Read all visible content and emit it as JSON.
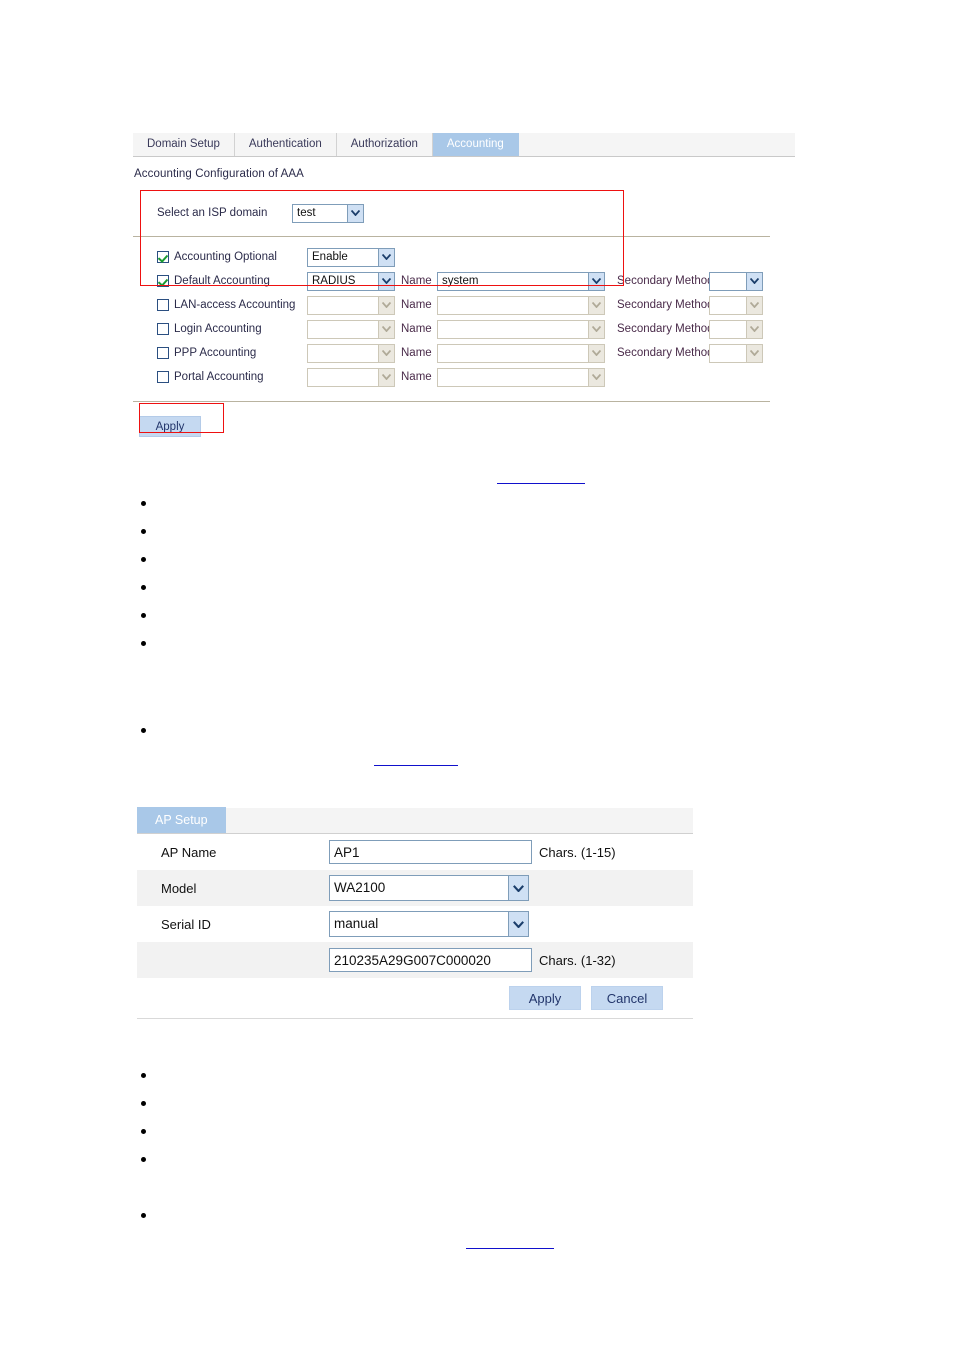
{
  "aaa": {
    "tabs": [
      {
        "label": "Domain Setup",
        "active": false
      },
      {
        "label": "Authentication",
        "active": false
      },
      {
        "label": "Authorization",
        "active": false
      },
      {
        "label": "Accounting",
        "active": true
      }
    ],
    "caption": "Accounting Configuration of AAA",
    "isp": {
      "label": "Select an ISP domain",
      "value": "test"
    },
    "rows": [
      {
        "checkbox_label": "Accounting Optional",
        "checked": true,
        "method": "Enable",
        "method_enabled": true,
        "has_name": false,
        "name_label": "",
        "name_value": "",
        "name_enabled": false,
        "has_secondary": false,
        "secondary_label": "",
        "secondary_value": "",
        "secondary_enabled": false
      },
      {
        "checkbox_label": "Default Accounting",
        "checked": true,
        "method": "RADIUS",
        "method_enabled": true,
        "has_name": true,
        "name_label": "Name",
        "name_value": "system",
        "name_enabled": true,
        "has_secondary": true,
        "secondary_label": "Secondary Method",
        "secondary_value": "",
        "secondary_enabled": true
      },
      {
        "checkbox_label": "LAN-access Accounting",
        "checked": false,
        "method": "",
        "method_enabled": false,
        "has_name": true,
        "name_label": "Name",
        "name_value": "",
        "name_enabled": false,
        "has_secondary": true,
        "secondary_label": "Secondary Method",
        "secondary_value": "",
        "secondary_enabled": false
      },
      {
        "checkbox_label": "Login Accounting",
        "checked": false,
        "method": "",
        "method_enabled": false,
        "has_name": true,
        "name_label": "Name",
        "name_value": "",
        "name_enabled": false,
        "has_secondary": true,
        "secondary_label": "Secondary Method",
        "secondary_value": "",
        "secondary_enabled": false
      },
      {
        "checkbox_label": "PPP Accounting",
        "checked": false,
        "method": "",
        "method_enabled": false,
        "has_name": true,
        "name_label": "Name",
        "name_value": "",
        "name_enabled": false,
        "has_secondary": true,
        "secondary_label": "Secondary Method",
        "secondary_value": "",
        "secondary_enabled": false
      },
      {
        "checkbox_label": "Portal Accounting",
        "checked": false,
        "method": "",
        "method_enabled": false,
        "has_name": true,
        "name_label": "Name",
        "name_value": "",
        "name_enabled": false,
        "has_secondary": false,
        "secondary_label": "",
        "secondary_value": "",
        "secondary_enabled": false
      }
    ],
    "apply_label": "Apply"
  },
  "ap_setup": {
    "tab_label": "AP Setup",
    "rows": [
      {
        "label": "AP Name",
        "control": "text",
        "value": "AP1",
        "hint": "Chars. (1-15)"
      },
      {
        "label": "Model",
        "control": "select",
        "value": "WA2100",
        "hint": ""
      },
      {
        "label": "Serial ID",
        "control": "select",
        "value": "manual",
        "hint": ""
      },
      {
        "label": "",
        "control": "text",
        "value": "210235A29G007C000020",
        "hint": "Chars. (1-32)"
      }
    ],
    "apply_label": "Apply",
    "cancel_label": "Cancel"
  },
  "annotations": {
    "highlight_color": "#ee1111",
    "link_color": "#1111cc"
  },
  "bullets_upper": {
    "count": 6
  },
  "bullets_upper_extra": {
    "count": 1
  },
  "bullets_lower": {
    "count": 4
  },
  "bullets_lower_extra": {
    "count": 1
  }
}
